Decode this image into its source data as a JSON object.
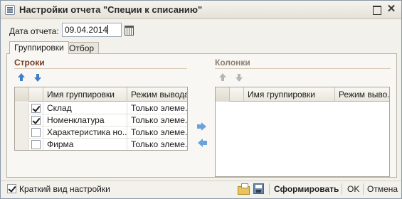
{
  "window": {
    "title": "Настройки отчета \"Специи к списанию\"",
    "restore_icon": "restore-icon",
    "close_glyph": "✕"
  },
  "report_date": {
    "label": "Дата отчета:",
    "value": "09.04.2014",
    "calendar_icon": "calendar-icon"
  },
  "tabs": [
    {
      "label": "Группировки",
      "active": true
    },
    {
      "label": "Отбор",
      "active": false
    }
  ],
  "rows": {
    "title": "Строки",
    "columns": [
      "Имя группировки",
      "Режим вывода"
    ],
    "items": [
      {
        "checked": true,
        "name": "Склад",
        "mode": "Только элеме..."
      },
      {
        "checked": true,
        "name": "Номенклатура",
        "mode": "Только элеме..."
      },
      {
        "checked": false,
        "name": "Характеристика но...",
        "mode": "Только элеме..."
      },
      {
        "checked": false,
        "name": "Фирма",
        "mode": "Только элеме..."
      }
    ]
  },
  "columns_section": {
    "title": "Колонки",
    "columns": [
      "Имя группировки",
      "Режим выво..."
    ],
    "items": []
  },
  "footer": {
    "short_view_label": "Краткий вид настройки",
    "short_view_checked": true,
    "generate_label": "Сформировать",
    "ok_label": "OK",
    "cancel_label": "Отмена"
  },
  "colors": {
    "section_title": "#7a3d23",
    "accent_arrow": "#3f7fc9"
  }
}
